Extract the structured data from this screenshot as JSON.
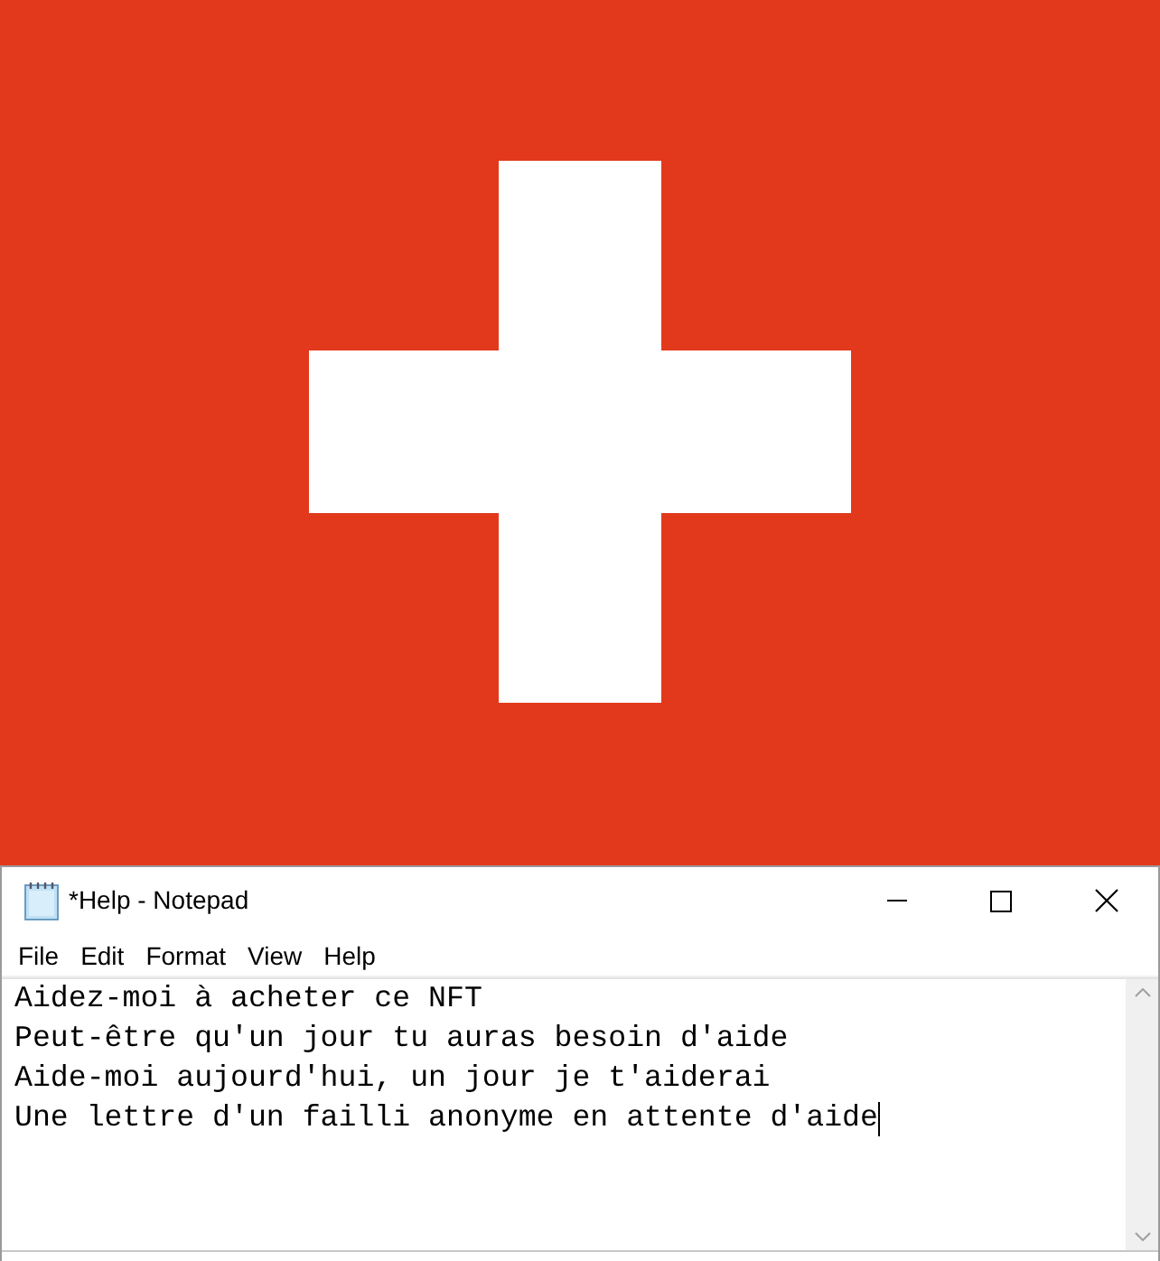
{
  "window": {
    "title": "*Help - Notepad"
  },
  "menu": [
    "File",
    "Edit",
    "Format",
    "View",
    "Help"
  ],
  "editor": {
    "lines": [
      "Aidez-moi à acheter ce NFT",
      "Peut-être qu'un jour tu auras besoin d'aide",
      "Aide-moi aujourd'hui, un jour je t'aiderai",
      "Une lettre d'un failli anonyme en attente d'aide"
    ],
    "cursor_at_end": true
  }
}
